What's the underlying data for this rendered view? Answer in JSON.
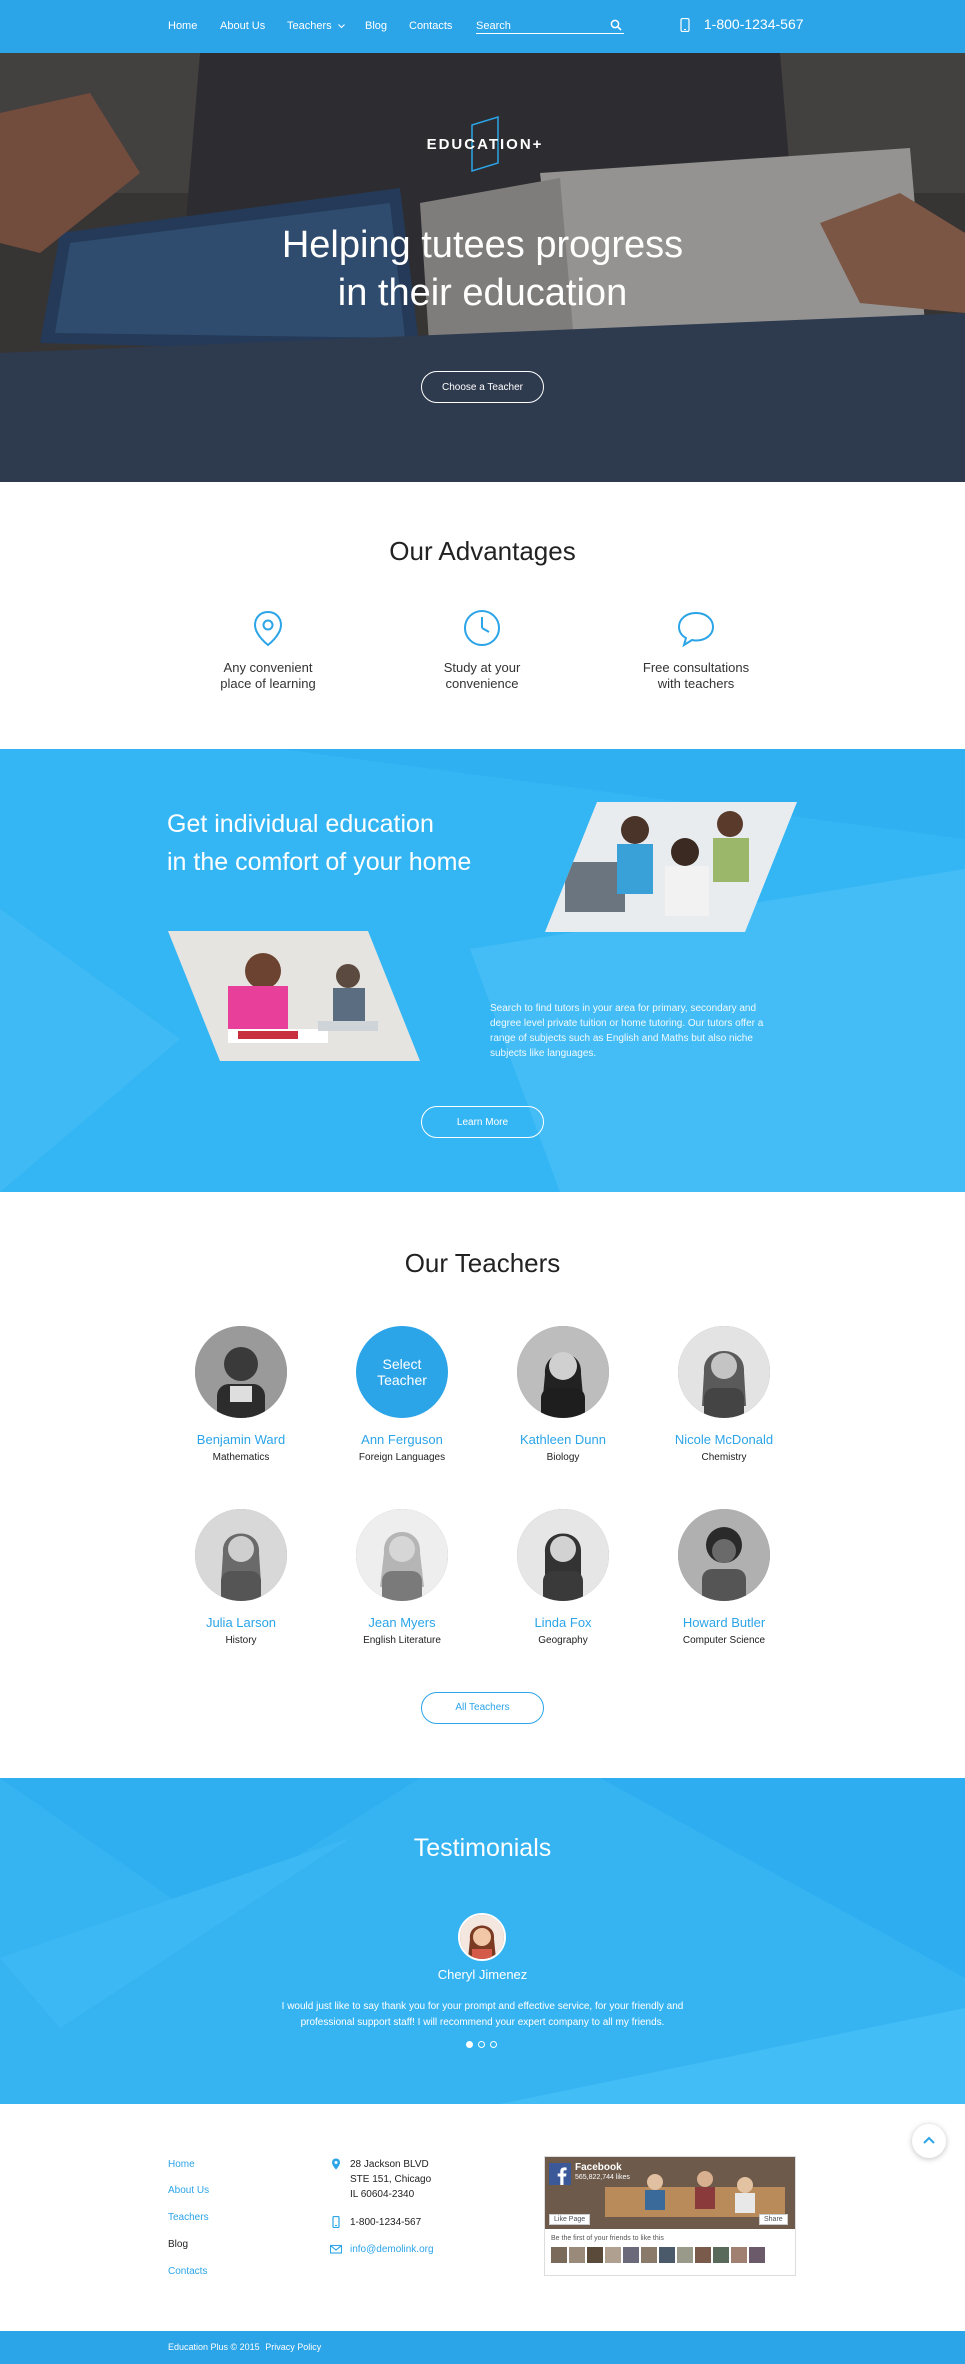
{
  "nav": {
    "items": [
      "Home",
      "About Us",
      "Teachers",
      "Blog",
      "Contacts"
    ],
    "search_placeholder": "Search",
    "phone": "1-800-1234-567"
  },
  "hero": {
    "logo": "EDUCATION+",
    "title_line1": "Helping tutees progress",
    "title_line2": "in their education",
    "button": "Choose a Teacher"
  },
  "advantages": {
    "title": "Our Advantages",
    "items": [
      {
        "icon": "location-pin-icon",
        "line1": "Any convenient",
        "line2": "place of learning"
      },
      {
        "icon": "clock-icon",
        "line1": "Study at your",
        "line2": "convenience"
      },
      {
        "icon": "chat-bubble-icon",
        "line1": "Free consultations",
        "line2": "with teachers"
      }
    ]
  },
  "band": {
    "title_line1": "Get individual education",
    "title_line2": "in the comfort of your home",
    "text": "Search to find tutors in your area for primary, secondary and degree level private tuition or home tutoring. Our tutors offer a range of subjects such as English and Maths but also niche subjects like languages.",
    "button": "Learn More"
  },
  "teachers": {
    "title": "Our Teachers",
    "select_label": "Select Teacher",
    "list": [
      {
        "name": "Benjamin Ward",
        "subject": "Mathematics"
      },
      {
        "name": "Ann Ferguson",
        "subject": "Foreign Languages"
      },
      {
        "name": "Kathleen Dunn",
        "subject": "Biology"
      },
      {
        "name": "Nicole McDonald",
        "subject": "Chemistry"
      },
      {
        "name": "Julia Larson",
        "subject": "History"
      },
      {
        "name": "Jean Myers",
        "subject": "English Literature"
      },
      {
        "name": "Linda Fox",
        "subject": "Geography"
      },
      {
        "name": "Howard Butler",
        "subject": "Computer Science"
      }
    ],
    "button": "All Teachers"
  },
  "testimonials": {
    "title": "Testimonials",
    "name": "Cheryl Jimenez",
    "quote": "I would just like to say thank you for your prompt and effective service, for your friendly and professional support staff! I will recommend your expert company to all my friends."
  },
  "footer": {
    "links": [
      "Home",
      "About Us",
      "Teachers",
      "Blog",
      "Contacts"
    ],
    "address_line1": "28 Jackson BLVD",
    "address_line2": "STE 151, Chicago",
    "address_line3": "IL 60604-2340",
    "phone": "1-800-1234-567",
    "email": "info@demolink.org",
    "fb_title": "Facebook",
    "fb_likes": "565,822,744 likes",
    "fb_like_btn": "Like Page",
    "fb_share_btn": "Share",
    "fb_friends": "Be the first of your friends to like this",
    "copyright": "Education Plus © 2015",
    "privacy": "Privacy Policy"
  },
  "colors": {
    "primary": "#2ba4e8",
    "band": "#35b6f4"
  }
}
